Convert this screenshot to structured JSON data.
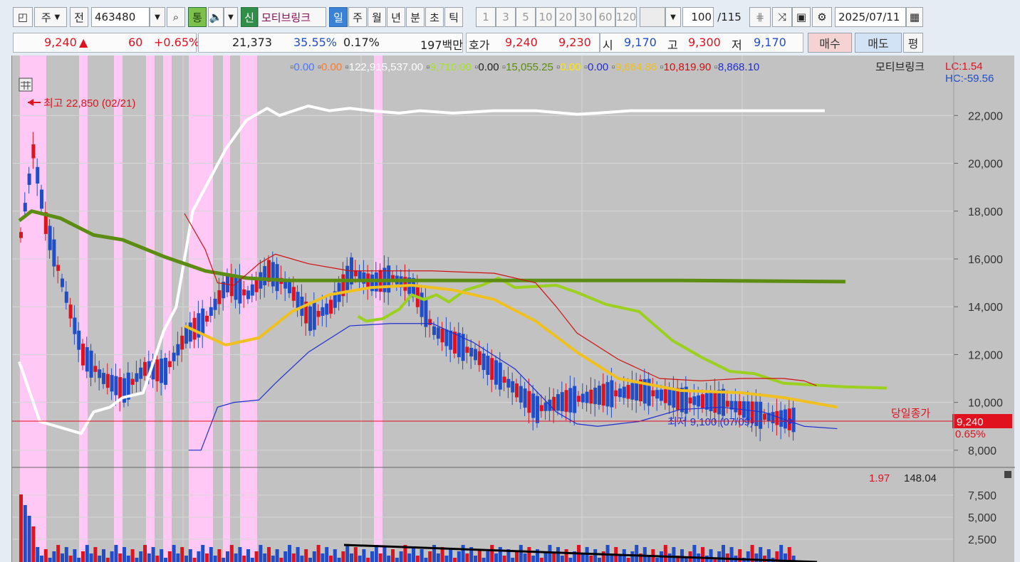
{
  "toolbar": {
    "market": "주",
    "mode": "전",
    "code": "463480",
    "btn_tong": "통",
    "btn_sin": "신",
    "stock_name": "모티브링크",
    "periods": [
      "일",
      "주",
      "월",
      "년",
      "분",
      "초",
      "틱"
    ],
    "intervals": [
      "1",
      "3",
      "5",
      "10",
      "20",
      "30",
      "60",
      "120"
    ],
    "count": "100",
    "count_total": "/115",
    "date": "2025/07/11"
  },
  "quote": {
    "price": "9,240",
    "change_arrow": "▲",
    "change": "60",
    "change_pct": "+0.65%",
    "volume": "21,373",
    "turnover_pct": "35.55%",
    "ratio": "0.17%",
    "amount": "197백만",
    "hoga_label": "호가",
    "ask": "9,240",
    "bid": "9,230",
    "open_label": "시",
    "open": "9,170",
    "high_label": "고",
    "high": "9,300",
    "low_label": "저",
    "low": "9,170",
    "buy": "매수",
    "sell": "매도",
    "flat": "평"
  },
  "legend": {
    "items": [
      {
        "text": "0.00",
        "color": "#4a76ff"
      },
      {
        "text": "0.00",
        "color": "#ff7a2a"
      },
      {
        "text": "122,915,537.00",
        "color": "#ffffff"
      },
      {
        "text": "9,710.00",
        "color": "#a6e22e"
      },
      {
        "text": "0.00",
        "color": "#222222"
      },
      {
        "text": "15,055.25",
        "color": "#5c8c12"
      },
      {
        "text": "0.00",
        "color": "#ffe600"
      },
      {
        "text": "0.00",
        "color": "#1f2fd0"
      },
      {
        "text": "9,664.86",
        "color": "#f0c020"
      },
      {
        "text": "10,819.90",
        "color": "#d01010"
      },
      {
        "text": "8,868.10",
        "color": "#1f2fd0"
      }
    ],
    "name": "모티브링크",
    "lc": "LC:1.54",
    "hc": "HC:-59.56"
  },
  "annotations": {
    "high": "최고 22,850 (02/21)",
    "low": "최저 9,100 (07/09)",
    "close_label": "당일종가",
    "close_value": "9,240",
    "close_pct": "0.65%"
  },
  "volume_legend": {
    "a": "1.97",
    "b": "148.04"
  },
  "colors": {
    "up": "#e0121e",
    "down": "#1f4ec8",
    "highlight": "#ffc8f5",
    "chart_bg": "#c2c2c2"
  },
  "chart_data": {
    "type": "line",
    "price_ticks": [
      "22,000",
      "20,000",
      "18,000",
      "16,000",
      "14,000",
      "12,000",
      "10,000",
      "8,000"
    ],
    "price_range": [
      7400,
      23200
    ],
    "volume_ticks": [
      "7,500",
      "5,000",
      "2,500"
    ],
    "series": [
      {
        "name": "white",
        "color": "#ffffff",
        "values": [
          [
            0,
            11700
          ],
          [
            5,
            9200
          ],
          [
            15,
            8700
          ],
          [
            18,
            9600
          ],
          [
            22,
            9800
          ],
          [
            25,
            10200
          ],
          [
            30,
            10400
          ],
          [
            35,
            13000
          ],
          [
            38,
            14000
          ],
          [
            42,
            18000
          ],
          [
            46,
            19300
          ],
          [
            50,
            20600
          ],
          [
            55,
            21800
          ],
          [
            60,
            22300
          ],
          [
            63,
            22000
          ],
          [
            70,
            22400
          ],
          [
            75,
            22200
          ],
          [
            80,
            22300
          ],
          [
            85,
            22200
          ],
          [
            92,
            22100
          ],
          [
            97,
            22200
          ],
          [
            105,
            22100
          ],
          [
            115,
            22200
          ],
          [
            125,
            22200
          ],
          [
            135,
            22050
          ],
          [
            140,
            22100
          ],
          [
            148,
            22200
          ],
          [
            155,
            22200
          ],
          [
            175,
            22200
          ],
          [
            195,
            22200
          ]
        ]
      },
      {
        "name": "bright green",
        "color": "#9bd11e",
        "values": [
          [
            82,
            13600
          ],
          [
            84,
            13400
          ],
          [
            88,
            13500
          ],
          [
            92,
            13900
          ],
          [
            95,
            14500
          ],
          [
            98,
            14300
          ],
          [
            101,
            14500
          ],
          [
            104,
            14200
          ],
          [
            108,
            14700
          ],
          [
            112,
            14900
          ],
          [
            116,
            15200
          ],
          [
            120,
            14800
          ],
          [
            130,
            14900
          ],
          [
            135,
            14600
          ],
          [
            142,
            14100
          ],
          [
            150,
            13800
          ],
          [
            158,
            12600
          ],
          [
            165,
            11900
          ],
          [
            172,
            11300
          ],
          [
            178,
            11200
          ],
          [
            185,
            10800
          ],
          [
            200,
            10650
          ],
          [
            210,
            10600
          ]
        ]
      },
      {
        "name": "dark green",
        "color": "#5c8c12",
        "values": [
          [
            0,
            17600
          ],
          [
            3,
            18000
          ],
          [
            10,
            17700
          ],
          [
            18,
            17000
          ],
          [
            25,
            16800
          ],
          [
            35,
            16100
          ],
          [
            45,
            15500
          ],
          [
            55,
            15200
          ],
          [
            65,
            15100
          ],
          [
            80,
            15100
          ],
          [
            120,
            15100
          ],
          [
            160,
            15100
          ],
          [
            200,
            15050
          ]
        ]
      },
      {
        "name": "yellow",
        "color": "#f0c020",
        "values": [
          [
            40,
            13200
          ],
          [
            50,
            12400
          ],
          [
            58,
            12700
          ],
          [
            66,
            13800
          ],
          [
            75,
            14500
          ],
          [
            85,
            14800
          ],
          [
            95,
            14900
          ],
          [
            105,
            14700
          ],
          [
            115,
            14300
          ],
          [
            125,
            13400
          ],
          [
            135,
            12100
          ],
          [
            145,
            11000
          ],
          [
            160,
            10500
          ],
          [
            175,
            10400
          ],
          [
            185,
            10200
          ],
          [
            198,
            9800
          ]
        ]
      },
      {
        "name": "red band",
        "color": "#d01010",
        "values": [
          [
            40,
            17900
          ],
          [
            45,
            16400
          ],
          [
            48,
            15000
          ],
          [
            52,
            14900
          ],
          [
            58,
            15800
          ],
          [
            62,
            16200
          ],
          [
            70,
            15800
          ],
          [
            80,
            15500
          ],
          [
            90,
            15500
          ],
          [
            100,
            15500
          ],
          [
            115,
            15400
          ],
          [
            125,
            15000
          ],
          [
            130,
            14000
          ],
          [
            135,
            12900
          ],
          [
            145,
            11800
          ],
          [
            155,
            11000
          ],
          [
            165,
            10900
          ],
          [
            175,
            11000
          ],
          [
            185,
            11000
          ],
          [
            190,
            10900
          ],
          [
            193,
            10700
          ]
        ]
      },
      {
        "name": "blue band",
        "color": "#1f2fd0",
        "values": [
          [
            41,
            8000
          ],
          [
            44,
            8000
          ],
          [
            48,
            9800
          ],
          [
            52,
            10000
          ],
          [
            58,
            10100
          ],
          [
            62,
            10800
          ],
          [
            70,
            12100
          ],
          [
            80,
            13200
          ],
          [
            90,
            13300
          ],
          [
            100,
            13300
          ],
          [
            105,
            12900
          ],
          [
            110,
            12500
          ],
          [
            120,
            11400
          ],
          [
            130,
            9600
          ],
          [
            135,
            9100
          ],
          [
            140,
            9000
          ],
          [
            145,
            9100
          ],
          [
            150,
            9200
          ],
          [
            160,
            9700
          ],
          [
            170,
            9800
          ],
          [
            180,
            9600
          ],
          [
            190,
            9000
          ],
          [
            198,
            8900
          ]
        ]
      }
    ]
  }
}
